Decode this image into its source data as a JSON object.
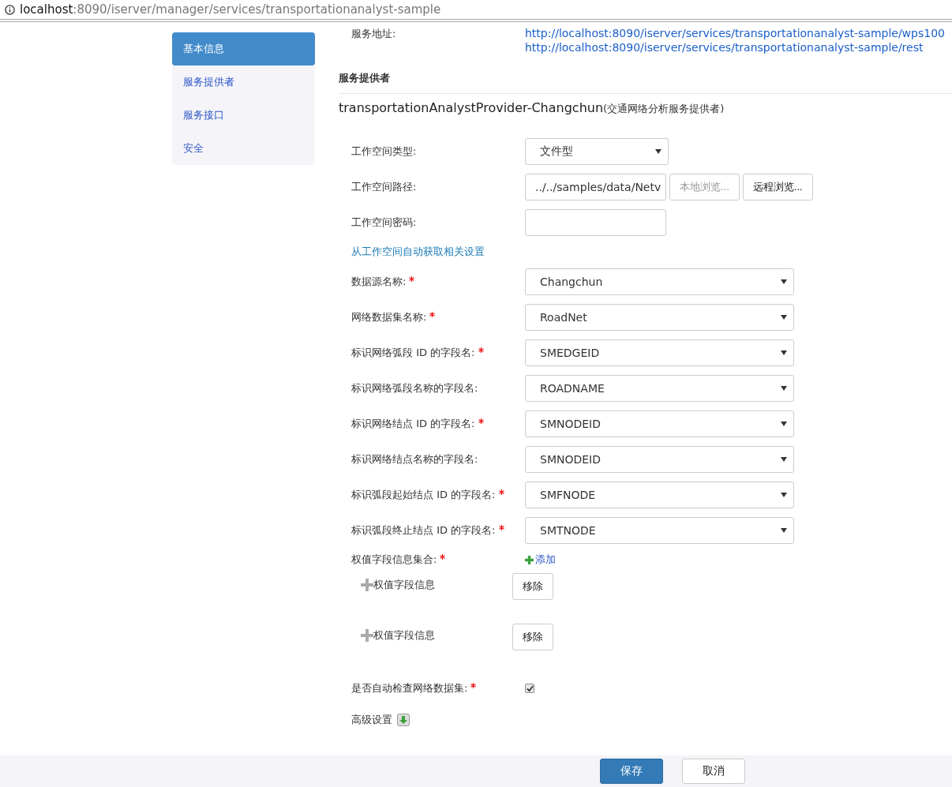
{
  "address_bar": {
    "host": "localhost",
    "path": ":8090/iserver/manager/services/transportationanalyst-sample"
  },
  "sidebar": {
    "items": [
      {
        "label": "基本信息",
        "selected": true
      },
      {
        "label": "服务提供者",
        "selected": false
      },
      {
        "label": "服务接口",
        "selected": false
      },
      {
        "label": "安全",
        "selected": false
      }
    ]
  },
  "service_address": {
    "label": "服务地址:",
    "links": [
      "http://localhost:8090/iserver/services/transportationanalyst-sample/wps100",
      "http://localhost:8090/iserver/services/transportationanalyst-sample/rest"
    ]
  },
  "section_title": "服务提供者",
  "provider": {
    "name": "transportationAnalystProvider-Changchun",
    "description": "(交通网络分析服务提供者)"
  },
  "workspace_fields": [
    {
      "kind": "select",
      "label": "工作空间类型:",
      "value": "文件型"
    },
    {
      "kind": "path",
      "label": "工作空间路径:",
      "value": "../../samples/data/Netv",
      "buttons": [
        {
          "label": "本地浏览...",
          "disabled": true
        },
        {
          "label": "远程浏览...",
          "disabled": false
        }
      ]
    },
    {
      "kind": "password",
      "label": "工作空间密码:"
    }
  ],
  "auto_settings_link": "从工作空间自动获取相关设置",
  "fields": [
    {
      "label": "数据源名称:",
      "required": true,
      "value": "Changchun"
    },
    {
      "label": "网络数据集名称:",
      "required": true,
      "value": "RoadNet"
    },
    {
      "label": "标识网络弧段 ID 的字段名:",
      "required": true,
      "value": "SMEDGEID"
    },
    {
      "label": "标识网络弧段名称的字段名:",
      "required": false,
      "value": "ROADNAME"
    },
    {
      "label": "标识网络结点 ID 的字段名:",
      "required": true,
      "value": "SMNODEID"
    },
    {
      "label": "标识网络结点名称的字段名:",
      "required": false,
      "value": "SMNODEID"
    },
    {
      "label": "标识弧段起始结点 ID 的字段名:",
      "required": true,
      "value": "SMFNODE"
    },
    {
      "label": "标识弧段终止结点 ID 的字段名:",
      "required": true,
      "value": "SMTNODE"
    }
  ],
  "weights": {
    "label": "权值字段信息集合:",
    "required": true,
    "add": "添加",
    "items": [
      {
        "label": "权值字段信息",
        "remove": "移除"
      },
      {
        "label": "权值字段信息",
        "remove": "移除"
      }
    ]
  },
  "auto_check": {
    "label": "是否自动检查网络数据集:",
    "required": true,
    "checked": true
  },
  "advanced": {
    "label": "高级设置"
  },
  "footer": {
    "buttons": [
      {
        "label": "保存",
        "primary": true
      },
      {
        "label": "取消",
        "primary": false
      }
    ]
  }
}
